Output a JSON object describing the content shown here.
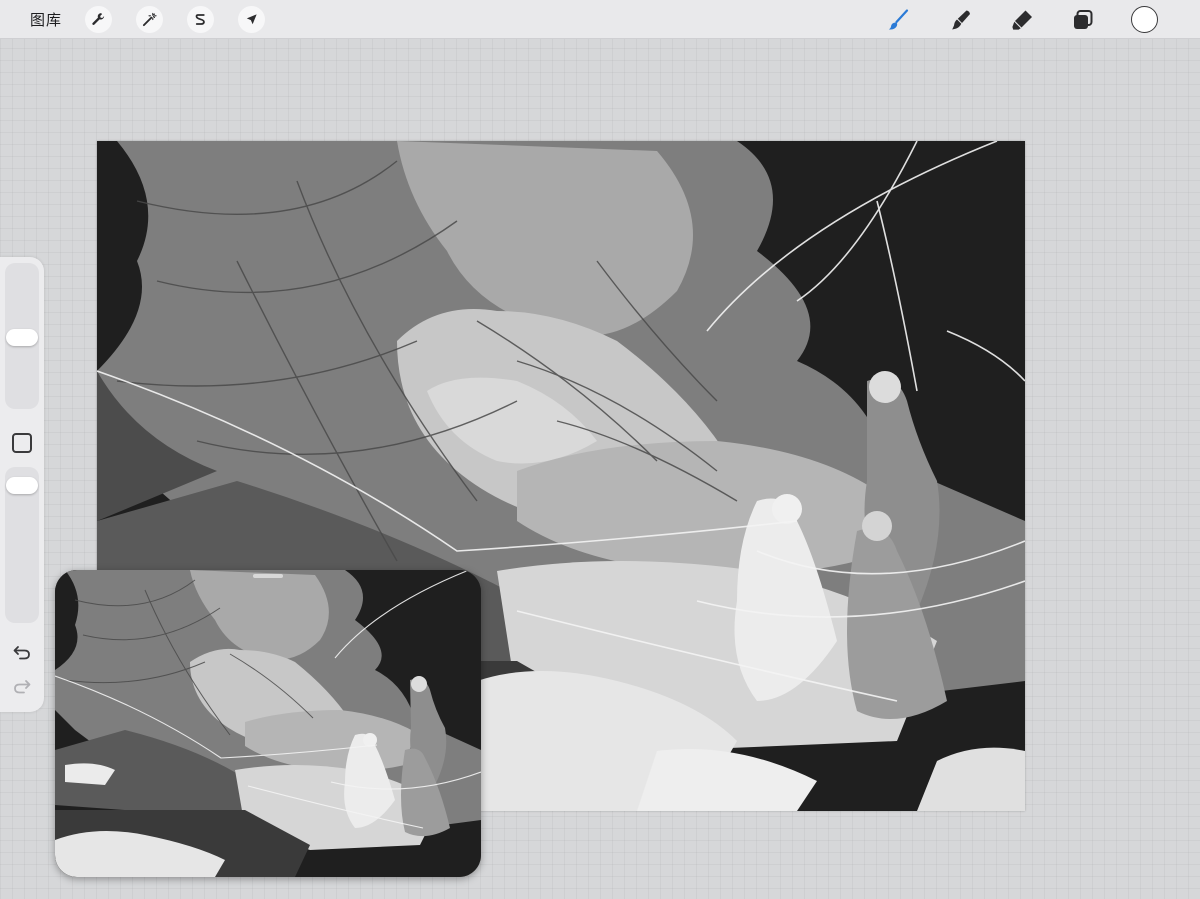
{
  "toolbar": {
    "gallery_label": "图库",
    "left_tools": [
      {
        "name": "actions",
        "icon": "wrench-icon"
      },
      {
        "name": "adjustments",
        "icon": "magic-wand-icon"
      },
      {
        "name": "selection",
        "icon": "selection-s-icon"
      },
      {
        "name": "transform",
        "icon": "arrow-cursor-icon"
      }
    ],
    "right_tools": [
      {
        "name": "brush",
        "icon": "brush-icon",
        "active": true
      },
      {
        "name": "smudge",
        "icon": "smudge-icon",
        "active": false
      },
      {
        "name": "eraser",
        "icon": "eraser-icon",
        "active": false
      },
      {
        "name": "layers",
        "icon": "layers-icon",
        "active": false
      }
    ],
    "color": "#ffffff",
    "accent": "#2a7ad6"
  },
  "sidebar": {
    "brush_size_level": 0.52,
    "opacity_level": 0.95,
    "modify_icon": "square-icon",
    "undo_icon": "undo-icon",
    "redo_icon": "redo-icon"
  },
  "canvas": {
    "content": "grayscale-sketch-artwork"
  },
  "reference": {
    "content": "artwork-preview"
  }
}
